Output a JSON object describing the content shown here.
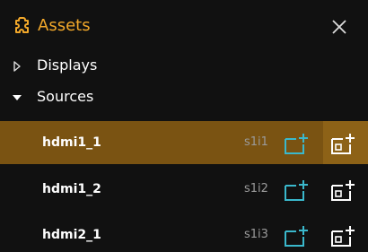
{
  "panel": {
    "title": "Assets",
    "accent_color": "#f2a82a",
    "header_icon": "puzzle-icon",
    "close_icon": "close-icon"
  },
  "tree": [
    {
      "label": "Displays",
      "expanded": false,
      "caret_icon": "caret-right-icon"
    },
    {
      "label": "Sources",
      "expanded": true,
      "caret_icon": "caret-down-icon"
    }
  ],
  "sources": [
    {
      "name": "hdmi1_1",
      "code": "s1i1",
      "selected": true
    },
    {
      "name": "hdmi1_2",
      "code": "s1i2",
      "selected": false
    },
    {
      "name": "hdmi2_1",
      "code": "s1i3",
      "selected": false
    }
  ],
  "colors": {
    "background": "#111111",
    "selected_row": "#7a5312",
    "selected_action_bg": "#8d6217",
    "add_icon_teal": "#3ab8cc",
    "add_icon_white": "#ffffff",
    "code_text": "#9a9a9a"
  },
  "icons": {
    "add_to_display": "add-to-display-icon",
    "add_window": "add-window-icon"
  }
}
